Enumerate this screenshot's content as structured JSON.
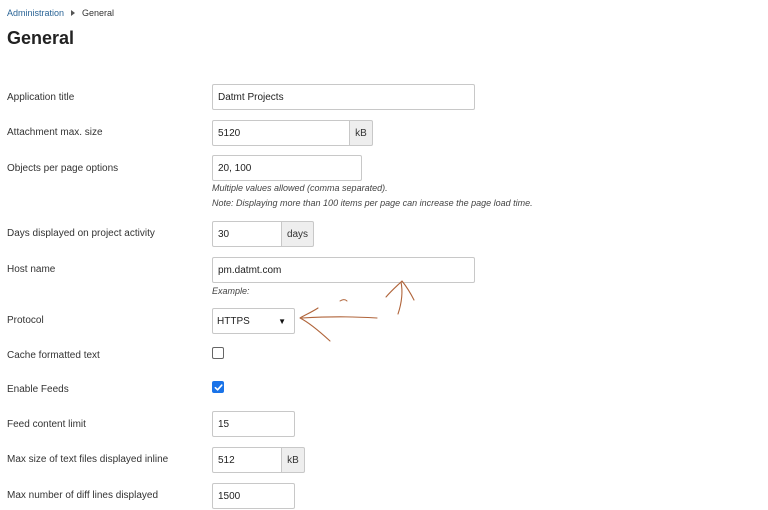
{
  "breadcrumb": {
    "parent": "Administration",
    "current": "General"
  },
  "page": {
    "title": "General"
  },
  "settings": {
    "app_title": {
      "label": "Application title",
      "value": "Datmt Projects"
    },
    "attachment_max_size": {
      "label": "Attachment max. size",
      "value": "5120",
      "unit": "kB"
    },
    "objects_per_page": {
      "label": "Objects per page options",
      "value": "20, 100",
      "hint_1": "Multiple values allowed (comma separated).",
      "hint_2": "Note: Displaying more than 100 items per page can increase the page load time."
    },
    "days_activity": {
      "label": "Days displayed on project activity",
      "value": "30",
      "unit": "days"
    },
    "host_name": {
      "label": "Host name",
      "value": "pm.datmt.com",
      "hint": "Example:"
    },
    "protocol": {
      "label": "Protocol",
      "value": "HTTPS"
    },
    "cache_formatted_text": {
      "label": "Cache formatted text",
      "checked": false
    },
    "enable_feeds": {
      "label": "Enable Feeds",
      "checked": true
    },
    "feed_content_limit": {
      "label": "Feed content limit",
      "value": "15"
    },
    "max_text_file_size": {
      "label": "Max size of text files displayed inline",
      "value": "512",
      "unit": "kB"
    },
    "max_diff_lines": {
      "label": "Max number of diff lines displayed",
      "value": "1500"
    }
  },
  "colors": {
    "link": "#2a6496",
    "checkbox_checked": "#1a73e8",
    "annotation_stroke": "#b0643a"
  },
  "icons": {
    "breadcrumb_separator": "caret-right-icon",
    "select_caret": "caret-down-icon",
    "checkmark": "checkmark-icon"
  }
}
